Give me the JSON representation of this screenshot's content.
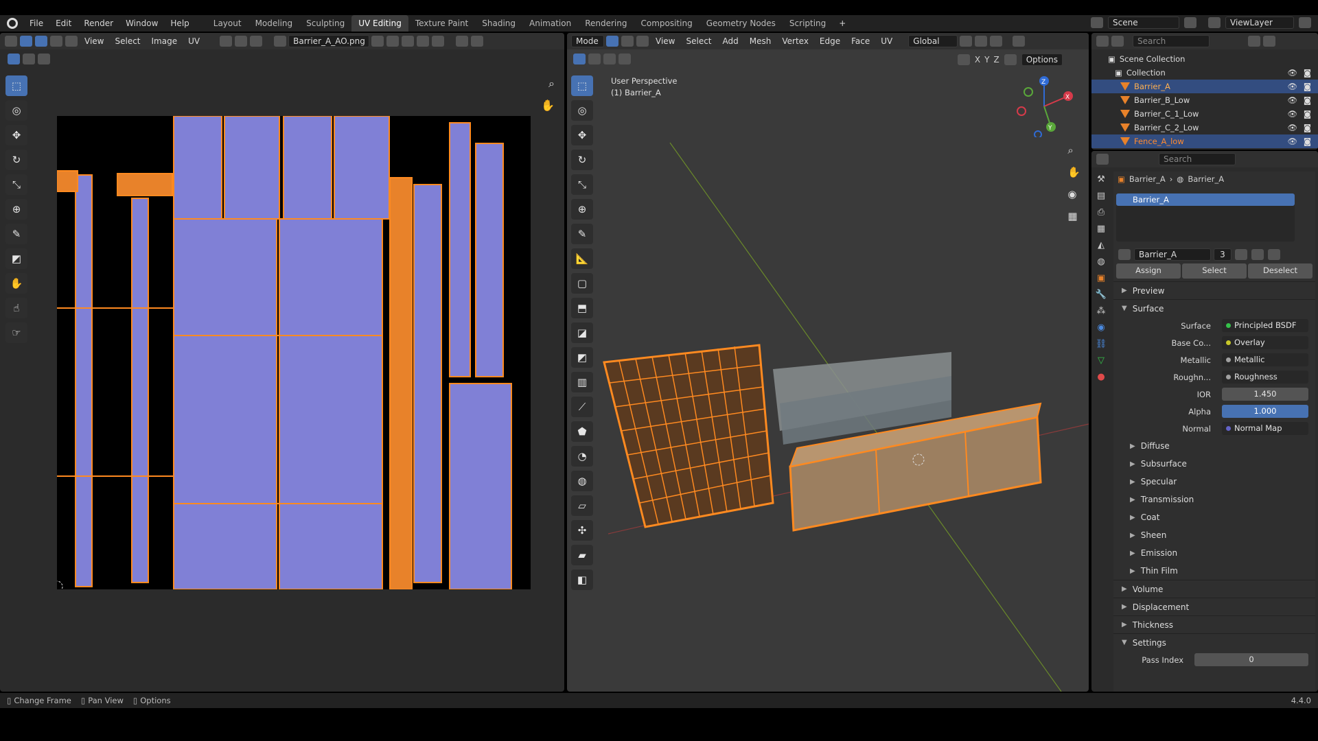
{
  "menu": {
    "file": "File",
    "edit": "Edit",
    "render": "Render",
    "window": "Window",
    "help": "Help"
  },
  "workspaces": [
    "Layout",
    "Modeling",
    "Sculpting",
    "UV Editing",
    "Texture Paint",
    "Shading",
    "Animation",
    "Rendering",
    "Compositing",
    "Geometry Nodes",
    "Scripting"
  ],
  "scene": {
    "name": "Scene",
    "view_layer": "ViewLayer"
  },
  "uv_editor": {
    "menus": [
      "View",
      "Select",
      "Image",
      "UV"
    ],
    "image_name": "Barrier_A_AO.png"
  },
  "viewport": {
    "mode": "Mode",
    "menus": [
      "View",
      "Select",
      "Add",
      "Mesh",
      "Vertex",
      "Edge",
      "Face",
      "UV"
    ],
    "orientation": "Global",
    "options": "Options",
    "axes": [
      "X",
      "Y",
      "Z"
    ],
    "overlay_title": "User Perspective",
    "overlay_object": "(1) Barrier_A",
    "gizmo": {
      "x": "X",
      "y": "Y",
      "z": "Z"
    }
  },
  "outliner": {
    "search": "Search",
    "root": "Scene Collection",
    "collection": "Collection",
    "items": [
      "Barrier_A",
      "Barrier_B_Low",
      "Barrier_C_1_Low",
      "Barrier_C_2_Low",
      "Fence_A_low"
    ]
  },
  "properties": {
    "search": "Search",
    "breadcrumb_obj": "Barrier_A",
    "breadcrumb_mat": "Barrier_A",
    "slot": "Barrier_A",
    "material_name": "Barrier_A",
    "users": "3",
    "assign": "Assign",
    "select": "Select",
    "deselect": "Deselect",
    "panels": {
      "preview": "Preview",
      "surface": "Surface"
    },
    "surface_rows": [
      {
        "label": "Surface",
        "value": "Principled BSDF",
        "color": "#35c24a"
      },
      {
        "label": "Base Co...",
        "value": "Overlay",
        "color": "#c7c729"
      },
      {
        "label": "Metallic",
        "value": "Metallic",
        "color": "#a1a1a1"
      },
      {
        "label": "Roughn...",
        "value": "Roughness",
        "color": "#a1a1a1"
      }
    ],
    "ior": {
      "label": "IOR",
      "value": "1.450"
    },
    "alpha": {
      "label": "Alpha",
      "value": "1.000"
    },
    "normal": {
      "label": "Normal",
      "value": "Normal Map",
      "color": "#6363c7"
    },
    "subpanels": [
      "Diffuse",
      "Subsurface",
      "Specular",
      "Transmission",
      "Coat",
      "Sheen",
      "Emission",
      "Thin Film"
    ],
    "sections": [
      "Volume",
      "Displacement",
      "Thickness",
      "Settings"
    ],
    "pass_index": {
      "label": "Pass Index",
      "value": "0"
    }
  },
  "status": {
    "change_frame": "Change Frame",
    "pan_view": "Pan View",
    "options": "Options",
    "version": "4.4.0"
  },
  "colors": {
    "accent": "#4772b3",
    "orange": "#ff8a20",
    "uv_face": "#7e7ed8"
  }
}
